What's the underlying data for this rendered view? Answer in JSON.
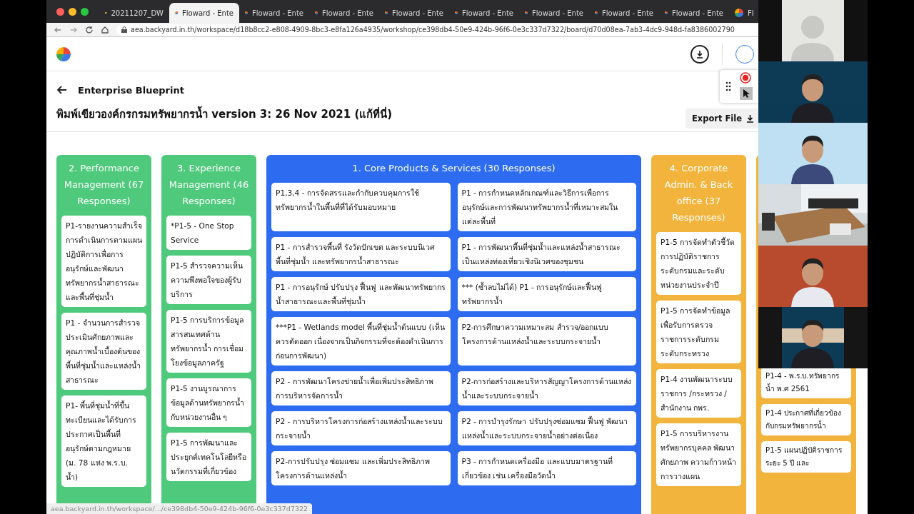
{
  "browser": {
    "tabs": [
      {
        "label": "20211207_DW",
        "selected": false,
        "kind": "slides"
      },
      {
        "label": "Floward - Ente",
        "selected": true,
        "kind": "app"
      },
      {
        "label": "Floward - Ente",
        "selected": false,
        "kind": "app"
      },
      {
        "label": "Floward - Ente",
        "selected": false,
        "kind": "app"
      },
      {
        "label": "Floward - Ente",
        "selected": false,
        "kind": "app"
      },
      {
        "label": "Floward - Ente",
        "selected": false,
        "kind": "app"
      },
      {
        "label": "Floward - Ente",
        "selected": false,
        "kind": "app"
      },
      {
        "label": "Floward - Ente",
        "selected": false,
        "kind": "app"
      },
      {
        "label": "Floward - Ente",
        "selected": false,
        "kind": "app"
      },
      {
        "label": "Fl",
        "selected": false,
        "kind": "app"
      }
    ],
    "url": "aea.backyard.in.th/workspace/d18b8cc2-e808-4909-8bc3-e8fa126a4935/workshop/ce398db4-50e9-424b-96f6-0e3c337d7322/board/d70d08ea-7ab3-4dc9-948d-fa8386002790"
  },
  "page": {
    "breadcrumb": "Enterprise Blueprint",
    "title": "พิมพ์เขียวองค์กรกรมทรัพยากรน้ำ version 3: 26 Nov 2021 (แก้ที่นี่)",
    "export_button": "Export File"
  },
  "columns": [
    {
      "title": "2. Performance Management (67 Responses)",
      "color": "#4fc97c",
      "kind": "single",
      "cards": [
        "P1-รายงานความสำเร็จการดำเนินการตามแผนปฏิบัติการเพื่อการอนุรักษ์และพัฒนาทรัพยากรน้ำสาธารณะและพื้นที่ชุ่มน้ำ",
        "P1 - จำนวนการสำรวจประเมินศักยภาพและคุณภาพน้ำเบื้องต้นของพื้นที่ชุ่มน้ำและแหล่งน้ำสาธารณะ",
        "P1- พื้นที่ชุ่มน้ำที่ขึ้นทะเบียนและได้รับการประกาศเป็นพื้นที่อนุรักษ์ตามกฎหมาย (ม. 78 แห่ง พ.ร.บ. น้ำ)"
      ]
    },
    {
      "title": "3. Experience Management (46 Responses)",
      "color": "#4fc97c",
      "kind": "single",
      "cards": [
        "*P1-5 - One Stop Service",
        "P1-5 สำรวจความเห็นความพึงพอใจของผู้รับบริการ",
        "P1-5 การบริการข้อมูลสารสนเทศด้านทรัพยากรน้ำ การเชื่อมโยงข้อมูลภาครัฐ",
        "P1-5 งานบูรณาการข้อมูลด้านทรัพยากรน้ำกับหน่วยงานอื่น ๆ",
        "P1-5 การพัฒนาและประยุกต์เทคโนโลยีหรือนวัตกรรมที่เกี่ยวข้อง"
      ]
    },
    {
      "title": "1. Core Products & Services (30 Responses)",
      "color": "#2d6cf0",
      "kind": "double",
      "cards": [
        "P1,3,4 - การจัดสรรและกำกับควบคุมการใช้ทรัพยากรน้ำในพื้นที่ที่ได้รับมอบหมาย",
        "P1 - การกำหนดหลักเกณฑ์และวิธีการเพื่อการอนุรักษ์และการพัฒนาทรัพยากรน้ำที่เหมาะสมในแต่ละพื้นที่",
        "P1 - การสำรวจพื้นที่ รังวัดปักเขต และระบบนิเวศพื้นที่ชุ่มน้ำ และทรัพยากรน้ำสาธารณะ",
        "P1 - การพัฒนาพื้นที่ชุ่มน้ำและแหล่งน้ำสาธารณะเป็นแหล่งท่องเที่ยวเชิงนิเวศของชุมชน",
        "P1 - การอนุรักษ์ ปรับปรุง ฟื้นฟู และพัฒนาทรัพยากรน้ำสาธารณะและพื้นที่ชุ่มน้ำ",
        "*** (ซ้ำลบไม่ได้) P1 - การอนุรักษ์และฟื้นฟูทรัพยากรน้ำ",
        "***P1 - Wetlands model พื้นที่ชุ่มน้ำต้นแบบ (เห็นควรตัดออก เนื่องจากเป็นกิจกรรมที่จะต้องดำเนินการก่อนการพัฒนา)",
        "P2-การศึกษาความเหมาะสม สำรวจ/ออกแบบโครงการด้านแหล่งน้ำและระบบกระจายน้ำ",
        "P2 - การพัฒนาโครงข่ายน้ำเพื่อเพิ่มประสิทธิภาพการบริหารจัดการน้ำ",
        "P2-การก่อสร้างและบริหารสัญญาโครงการด้านแหล่งน้ำและระบบกระจายน้ำ",
        "P2 - การบริหารโครงการก่อสร้างแหล่งน้ำและระบบกระจายน้ำ",
        "P2 - การบำรุงรักษา ปรับปรุงซ่อมแซม ฟื้นฟู พัฒนาแหล่งน้ำและระบบกระจายน้ำอย่างต่อเนื่อง",
        "P2-การปรับปรุง ซ่อมแซม และเพิ่มประสิทธิภาพโครงการด้านแหล่งน้ำ",
        "P3 - การกำหนดเครื่องมือ และแบบมาตรฐานที่เกี่ยวข้อง เช่น เครื่องมือวัดน้ำ"
      ]
    },
    {
      "title": "4. Corporate Admin. & Back office (37 Responses)",
      "color": "#f2b43c",
      "kind": "single",
      "cards": [
        "P1-5 การจัดทำตัวชี้วัดการปฏิบัติราชการระดับกรมและระดับหน่วยงานประจำปี",
        "P1-5 การจัดทำข้อมูลเพื่อรับการตรวจราชการระดับกรมระดับกระทรวง",
        "P1-4 งานพัฒนาระบบราชการ /กระทรวง / สำนักงาน กพร.",
        "P1-5 การบริหารงานทรัพยากรบุคคล พัฒนาศักยภาพ ความก้าวหน้า การวางแผน"
      ]
    },
    {
      "color": "#f2b43c",
      "kind": "single",
      "cards": [
        "P1-4 - พ.ร.บ.ทรัพยากรน้ำ พ.ศ 2561",
        "P1-4 ประกาศที่เกี่ยวข้องกับกรมทรัพยากรน้ำ",
        "P1-5 แผนปฏิบัติราชการ ระยะ 5 ปี และ"
      ]
    }
  ],
  "status_url": "aea.backyard.in.th/workspace/.../ce398db4-50e9-424b-96f6-0e3c337d7322",
  "video_tiles": [
    {
      "kind": "avatar"
    },
    {
      "kind": "person"
    },
    {
      "kind": "person"
    },
    {
      "kind": "picture"
    },
    {
      "kind": "person"
    },
    {
      "kind": "person"
    }
  ]
}
